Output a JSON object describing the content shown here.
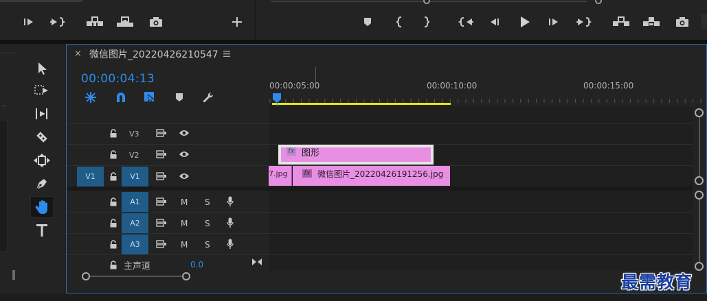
{
  "sequence": {
    "tab_title": "微信图片_20220426210547",
    "timecode": "00:00:04:13"
  },
  "ruler": {
    "labels": [
      "00:00:05:00",
      "00:00:10:00",
      "00:00:15:00"
    ]
  },
  "tracks": {
    "video": [
      {
        "label": "V3"
      },
      {
        "label": "V2"
      },
      {
        "label": "V1",
        "source_label": "V1"
      }
    ],
    "audio": [
      {
        "label": "A1",
        "m": "M",
        "s": "S"
      },
      {
        "label": "A2",
        "m": "M",
        "s": "S"
      },
      {
        "label": "A3",
        "m": "M",
        "s": "S"
      }
    ],
    "master": {
      "label": "主声道",
      "value": "0.0"
    }
  },
  "clips": {
    "graphic": {
      "fx": "fx",
      "name": "图形"
    },
    "image_prev": {
      "name": "7.jpg"
    },
    "image_main": {
      "fx": "fx",
      "name": "微信图片_20220426191256.jpg"
    }
  },
  "watermark": "最需教育",
  "colors": {
    "accent_blue": "#2d8ceb",
    "track_target": "#1f5c8a",
    "clip_pink": "#e88fe3",
    "work_area_yellow": "#e7e31c"
  }
}
